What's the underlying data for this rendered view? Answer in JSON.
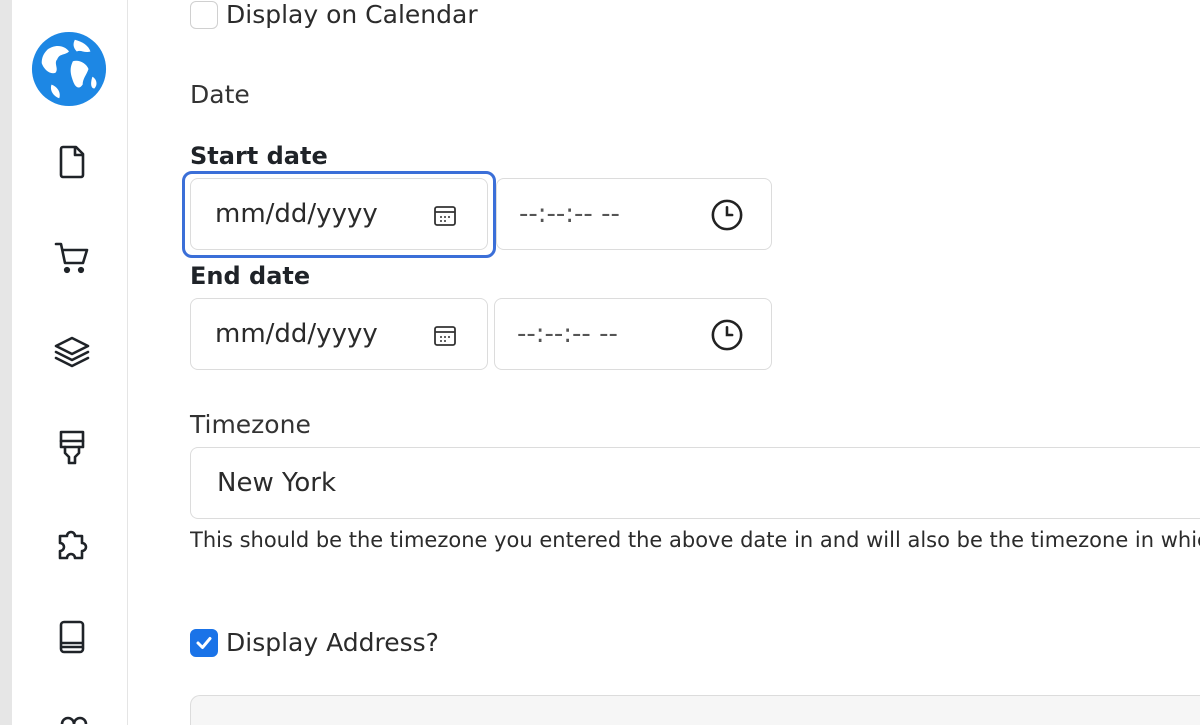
{
  "sidebar": {
    "logo": "globe-logo",
    "items": [
      {
        "icon": "document-icon"
      },
      {
        "icon": "cart-icon"
      },
      {
        "icon": "layers-icon"
      },
      {
        "icon": "brush-icon"
      },
      {
        "icon": "puzzle-icon"
      },
      {
        "icon": "book-icon"
      },
      {
        "icon": "partial-icon"
      }
    ]
  },
  "form": {
    "display_calendar": {
      "label": "Display on Calendar",
      "checked": false
    },
    "date_section_title": "Date",
    "start_date": {
      "label": "Start date",
      "date_placeholder": "mm/dd/yyyy",
      "time_placeholder": "--:--:-- --"
    },
    "end_date": {
      "label": "End date",
      "date_placeholder": "mm/dd/yyyy",
      "time_placeholder": "--:--:-- --"
    },
    "timezone": {
      "label": "Timezone",
      "value": "New York",
      "help": "This should be the timezone you entered the above date in and will also be the timezone in which"
    },
    "display_address": {
      "label": "Display Address?",
      "checked": true
    }
  },
  "colors": {
    "accent": "#1a73e8",
    "focus_ring": "#3b6fd8"
  }
}
